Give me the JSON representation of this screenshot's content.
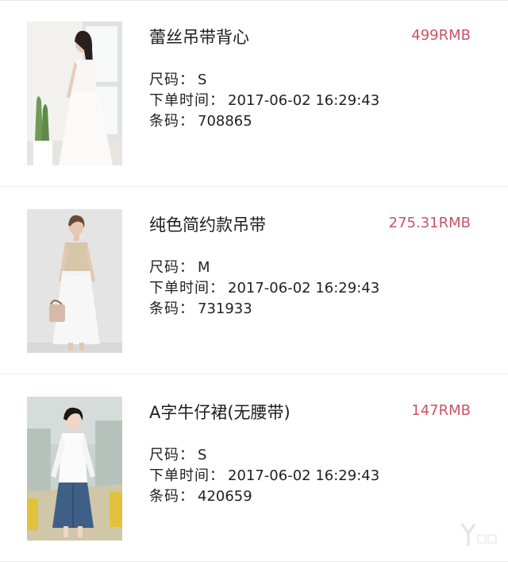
{
  "orders": [
    {
      "name": "蕾丝吊带背心",
      "price": "499RMB",
      "size_label": "尺码：",
      "size": "S",
      "time_label": "下单时间：",
      "time": "2017-06-02 16:29:43",
      "barcode_label": "条码：",
      "barcode": "708865",
      "image": "photo-woman-white-lace-dress-by-window"
    },
    {
      "name": "纯色简约款吊带",
      "price": "275.31RMB",
      "size_label": "尺码：",
      "size": "M",
      "time_label": "下单时间：",
      "time": "2017-06-02 16:29:43",
      "barcode_label": "条码：",
      "barcode": "731933",
      "image": "photo-woman-beige-camisole-lace-skirt"
    },
    {
      "name": "A字牛仔裙(无腰带)",
      "price": "147RMB",
      "size_label": "尺码：",
      "size": "S",
      "time_label": "下单时间：",
      "time": "2017-06-02 16:29:43",
      "barcode_label": "条码：",
      "barcode": "420659",
      "image": "photo-woman-white-shirt-denim-skirt"
    }
  ],
  "colors": {
    "price": "#c85467",
    "divider": "#ececec",
    "text": "#222222"
  },
  "watermark": {
    "icon": "yiou-logo-icon"
  }
}
